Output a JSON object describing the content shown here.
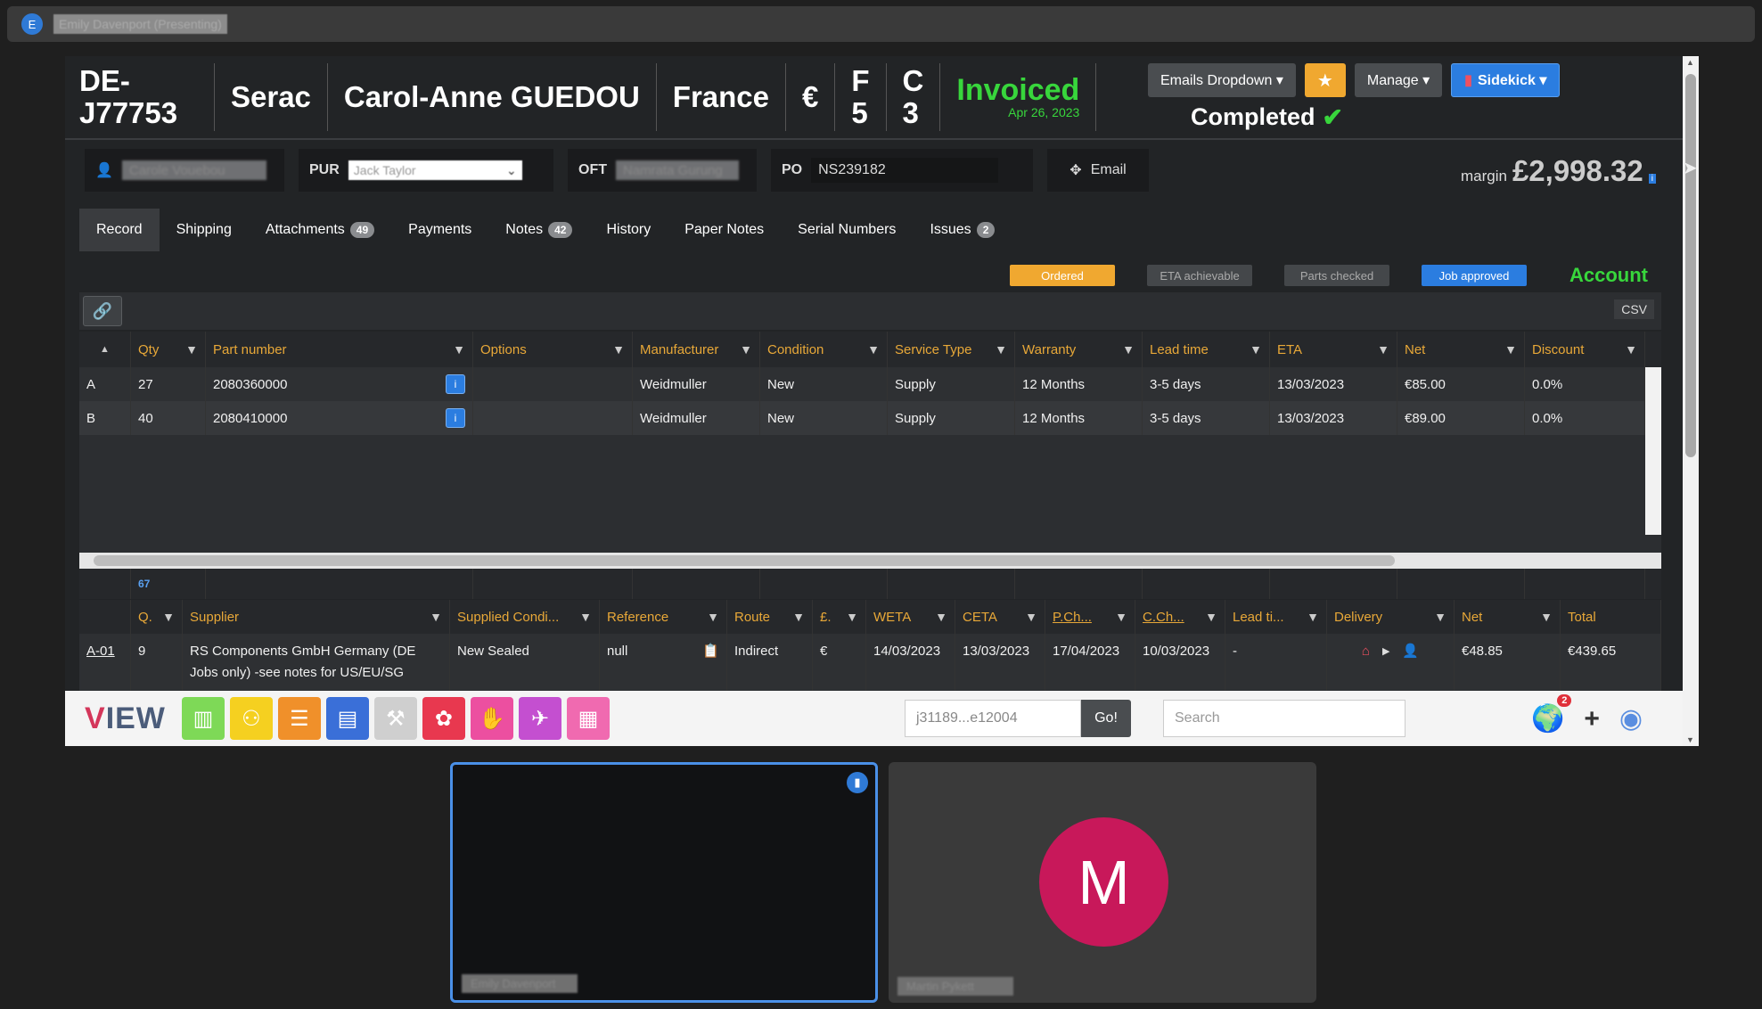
{
  "presenter": {
    "avatar_letter": "E",
    "name": "Emily Davenport (Presenting)"
  },
  "header": {
    "job_id": "DE-J77753",
    "company": "Serac",
    "contact": "Carol-Anne GUEDOU",
    "country": "France",
    "currency": "€",
    "f_label": "F",
    "f_value": "5",
    "c_label": "C",
    "c_value": "3",
    "status": "Invoiced",
    "status_date": "Apr 26, 2023",
    "completed": "Completed",
    "emails_dropdown": "Emails Dropdown ▾",
    "star": "★",
    "manage": "Manage ▾",
    "sidekick": "Sidekick ▾"
  },
  "fields": {
    "owner_value": "Carole Vouebou",
    "pur_label": "PUR",
    "pur_value": "Jack Taylor",
    "oft_label": "OFT",
    "oft_value": "Namrata Gurung",
    "po_label": "PO",
    "po_value": "NS239182",
    "email_button": "Email"
  },
  "margin": {
    "label": "margin",
    "value": "£2,998.32"
  },
  "tabs": [
    {
      "label": "Record",
      "badge": ""
    },
    {
      "label": "Shipping",
      "badge": ""
    },
    {
      "label": "Attachments",
      "badge": "49"
    },
    {
      "label": "Payments",
      "badge": ""
    },
    {
      "label": "Notes",
      "badge": "42"
    },
    {
      "label": "History",
      "badge": ""
    },
    {
      "label": "Paper Notes",
      "badge": ""
    },
    {
      "label": "Serial Numbers",
      "badge": ""
    },
    {
      "label": "Issues",
      "badge": "2"
    }
  ],
  "pills": {
    "ordered": "Ordered",
    "eta": "ETA achievable",
    "parts": "Parts checked",
    "approved": "Job approved",
    "account": "Account"
  },
  "grid1": {
    "csv": "CSV",
    "headers": [
      "▲",
      "Qty",
      "Part number",
      "Options",
      "Manufacturer",
      "Condition",
      "Service Type",
      "Warranty",
      "Lead time",
      "ETA",
      "Net",
      "Discount"
    ],
    "rows": [
      [
        "A",
        "27",
        "2080360000",
        "",
        "Weidmuller",
        "New",
        "Supply",
        "12 Months",
        "3-5 days",
        "13/03/2023",
        "€85.00",
        "0.0%"
      ],
      [
        "B",
        "40",
        "2080410000",
        "",
        "Weidmuller",
        "New",
        "Supply",
        "12 Months",
        "3-5 days",
        "13/03/2023",
        "€89.00",
        "0.0%"
      ]
    ],
    "sum_qty": "67"
  },
  "grid2": {
    "headers": [
      "",
      "Q.",
      "Supplier",
      "Supplied Condi...",
      "Reference",
      "Route",
      "£.",
      "WETA",
      "CETA",
      "P.Ch...",
      "C.Ch...",
      "Lead ti...",
      "Delivery",
      "Net",
      "Total"
    ],
    "row": [
      "A-01",
      "9",
      "RS Components GmbH Germany (DE Jobs only) -see notes for US/EU/SG",
      "New Sealed",
      "null",
      "Indirect",
      "€",
      "14/03/2023",
      "13/03/2023",
      "17/04/2023",
      "10/03/2023",
      "-",
      "",
      "€48.85",
      "€439.65"
    ]
  },
  "bottom": {
    "logo_v": "V",
    "logo_rest": "IEW",
    "job_search_value": "j31189...e12004",
    "go": "Go!",
    "search_placeholder": "Search",
    "notifications": "2"
  },
  "tiles": {
    "tile1_name": "Emily Davenport",
    "tile2_name": "Martin Pykett",
    "tile2_avatar": "M"
  },
  "colors": {
    "accent_green": "#38d63c",
    "accent_orange": "#f0a830",
    "accent_blue": "#2b7de0",
    "avatar_magenta": "#c8185a"
  }
}
